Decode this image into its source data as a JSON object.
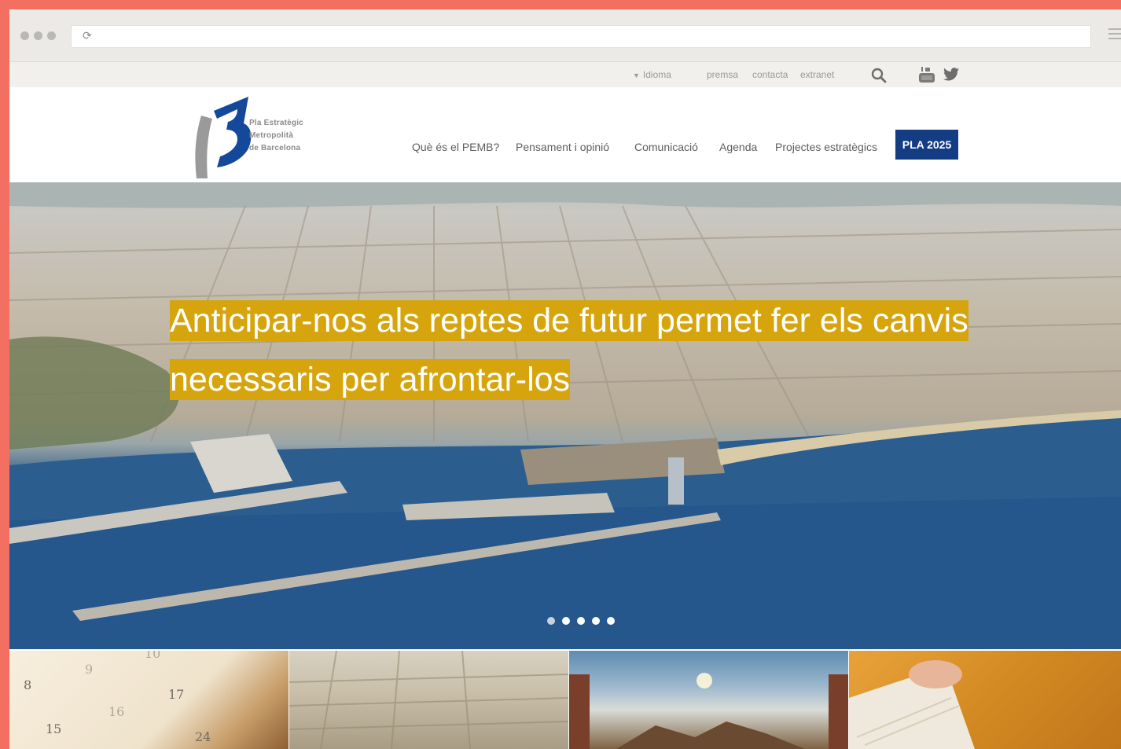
{
  "utility_bar": {
    "language": "Idioma",
    "links": [
      "premsa",
      "contacta",
      "extranet"
    ],
    "icons": [
      "search-icon",
      "youtube-icon",
      "twitter-icon"
    ]
  },
  "logo": {
    "line1": "Pla Estratègic",
    "line2": "Metropolità",
    "line3": "de Barcelona"
  },
  "nav": {
    "items": [
      "Què és el PEMB?",
      "Pensament i opinió",
      "Comunicació",
      "Agenda",
      "Projectes estratègics"
    ],
    "cta": "PLA 2025"
  },
  "hero": {
    "headline": "Anticipar-nos als reptes de futur permet fer els canvis necessaris per afrontar-los",
    "slides_total": 5,
    "active_slide": 1
  },
  "tiles": {
    "calendar_numbers": [
      "8",
      "9",
      "10",
      "15",
      "16",
      "17",
      "24"
    ]
  },
  "colors": {
    "frame": "#f26f62",
    "headline_highlight": "#d6a40c",
    "cta_background": "#133c83",
    "logo_blue": "#13489b",
    "logo_grey": "#8f8f8f"
  }
}
